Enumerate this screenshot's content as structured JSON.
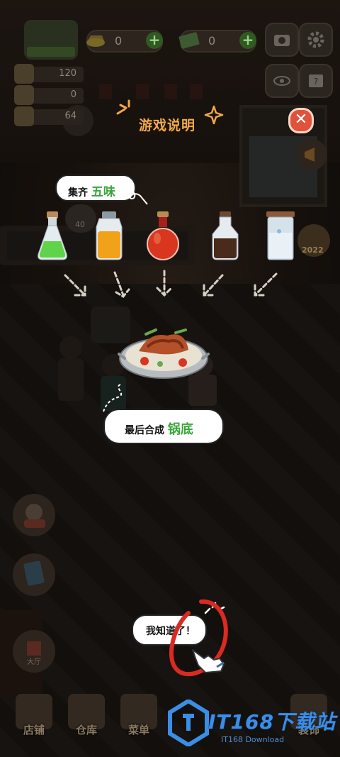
{
  "hud": {
    "coins": "0",
    "cash": "0",
    "stat1": "120",
    "stat2": "0",
    "stat3": "64"
  },
  "tutorial": {
    "title": "游戏说明",
    "collect_prefix": "集齐",
    "collect_highlight": "五味",
    "combine_prefix": "最后合成",
    "combine_highlight": "锅底",
    "confirm_label": "我知道了！"
  },
  "bottles": [
    {
      "name": "green",
      "color": "#5fd34a"
    },
    {
      "name": "orange",
      "color": "#f0a21a"
    },
    {
      "name": "red",
      "color": "#d8361e"
    },
    {
      "name": "brown",
      "color": "#4a2a1a"
    },
    {
      "name": "white",
      "color": "#e9f1f6"
    }
  ],
  "background": {
    "bubble_count": "40",
    "year_tag": "2022"
  },
  "bottom_nav": [
    {
      "label": "店铺"
    },
    {
      "label": "仓库"
    },
    {
      "label": "菜单"
    },
    {
      "label": "装饰"
    }
  ],
  "side": {
    "hall_label": "大厅"
  },
  "watermark": {
    "title": "IT168下载站",
    "subtitle": "IT168 Download"
  },
  "colors": {
    "title": "#f2a94a",
    "highlight": "#3aa63a",
    "close": "#e0523a",
    "ring": "#d92b22",
    "watermark": "#3b8ee6"
  }
}
